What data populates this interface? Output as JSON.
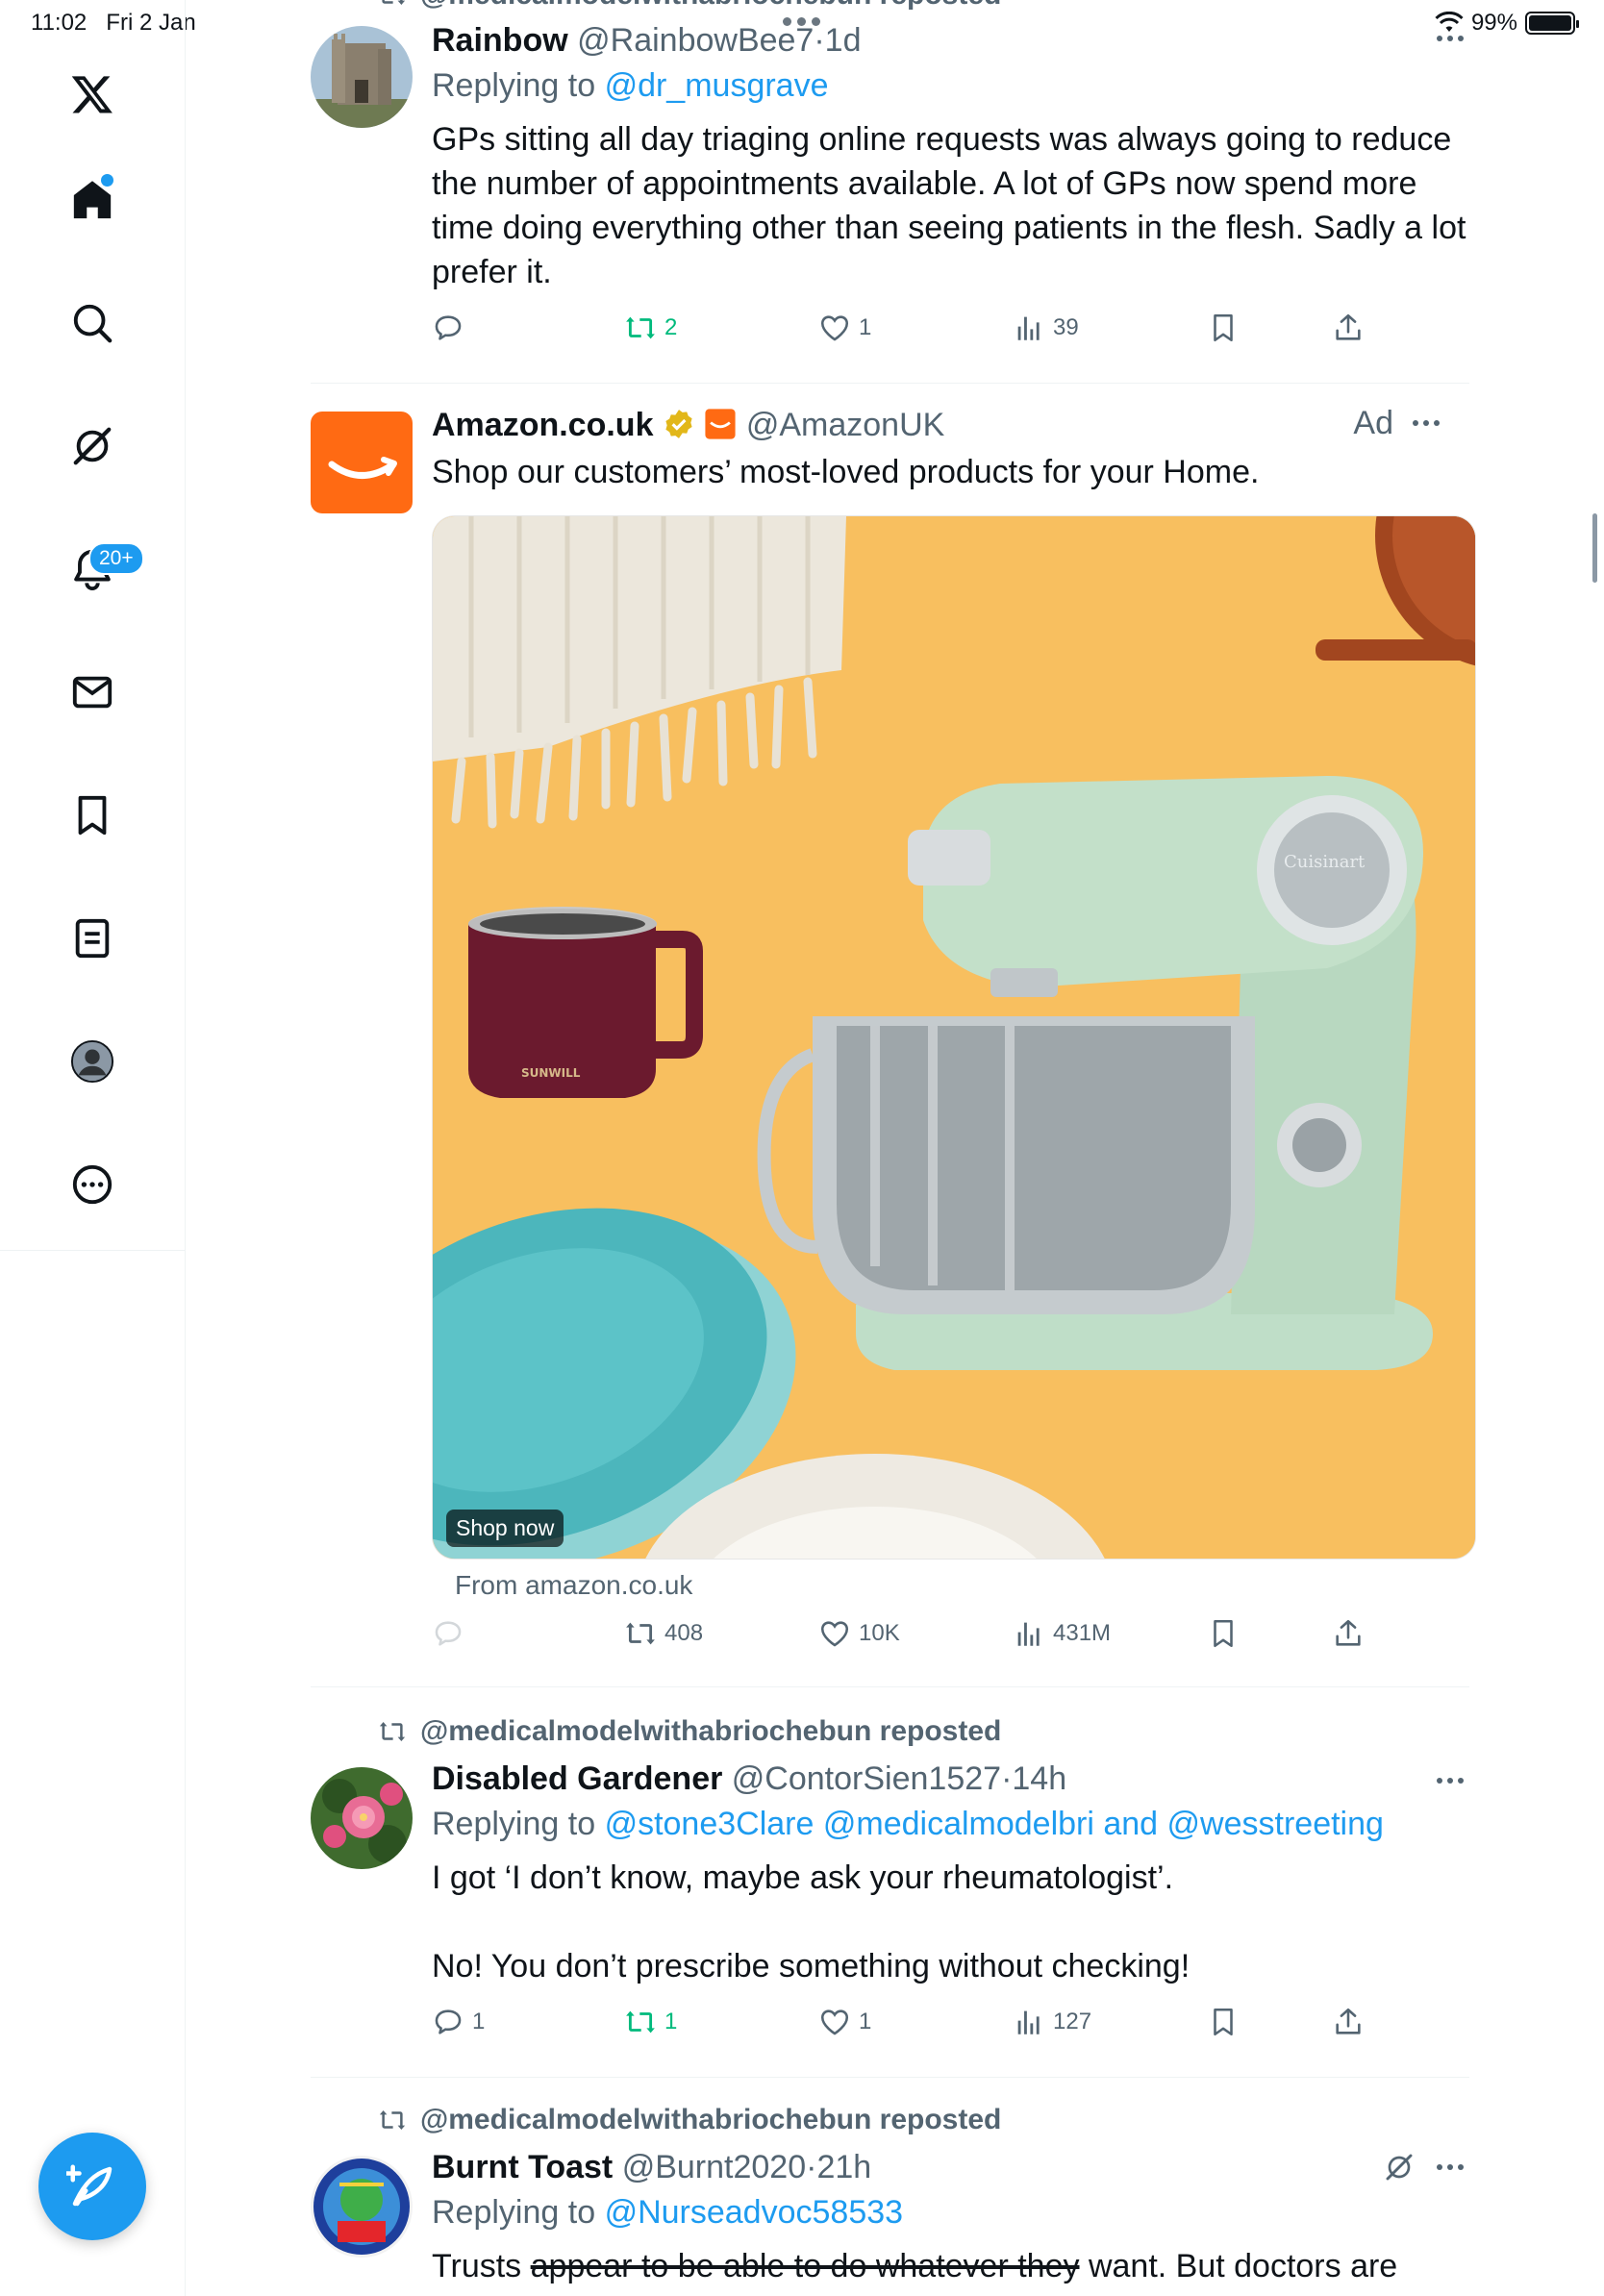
{
  "status_bar": {
    "time": "11:02",
    "date": "Fri 2 Jan",
    "battery": "99%"
  },
  "nav": {
    "notifications_badge": "20+",
    "items": [
      "x-logo-icon",
      "home-icon",
      "search-icon",
      "grok-icon",
      "notifications-icon",
      "messages-icon",
      "bookmarks-icon",
      "lists-icon",
      "profile-icon",
      "more-icon"
    ]
  },
  "colors": {
    "accent": "#1d9bf0",
    "retweet_green": "#00ba7c",
    "muted": "#536471",
    "text": "#0f1419"
  },
  "top_repost_partial": "@medicalmodelwithabriochebun reposted",
  "tweets": [
    {
      "name": "Rainbow",
      "handle": "@RainbowBee7",
      "time": "1d",
      "replying_label": "Replying to",
      "replying_to": "@dr_musgrave",
      "body": "GPs sitting all day triaging online requests was always going to reduce the number of appointments available. A lot of GPs now spend more time doing everything other than seeing patients in the flesh. Sadly a lot prefer it.",
      "replies": "",
      "reposts": "2",
      "likes": "1",
      "views": "39"
    },
    {
      "name": "Amazon.co.uk",
      "handle": "@AmazonUK",
      "ad_label": "Ad",
      "body": "Shop our customers’ most-loved products for your Home.",
      "cta": "Shop now",
      "from": "From amazon.co.uk",
      "mug_text": "SUNWILL",
      "mixer_brand": "Cuisinart",
      "replies": "",
      "reposts": "408",
      "likes": "10K",
      "views": "431M"
    },
    {
      "reposted_by": "@medicalmodelwithabriochebun reposted",
      "name": "Disabled Gardener",
      "handle": "@ContorSien1527",
      "time": "14h",
      "replying_label": "Replying to",
      "replying_to": "@stone3Clare @medicalmodelbri and @wesstreeting",
      "body_line1": "I got ‘I don’t know, maybe ask your rheumatologist’.",
      "body_line2": "No! You don’t prescribe something without checking!",
      "replies": "1",
      "reposts": "1",
      "likes": "1",
      "views": "127"
    },
    {
      "reposted_by": "@medicalmodelwithabriochebun reposted",
      "name": "Burnt Toast",
      "handle": "@Burnt2020",
      "time": "21h",
      "replying_label": "Replying to",
      "replying_to": "@Nurseadvoc58533",
      "body_start": "Trusts ",
      "body_struck": "appear to be able to do whatever they",
      "body_end": " want. But doctors are"
    }
  ]
}
